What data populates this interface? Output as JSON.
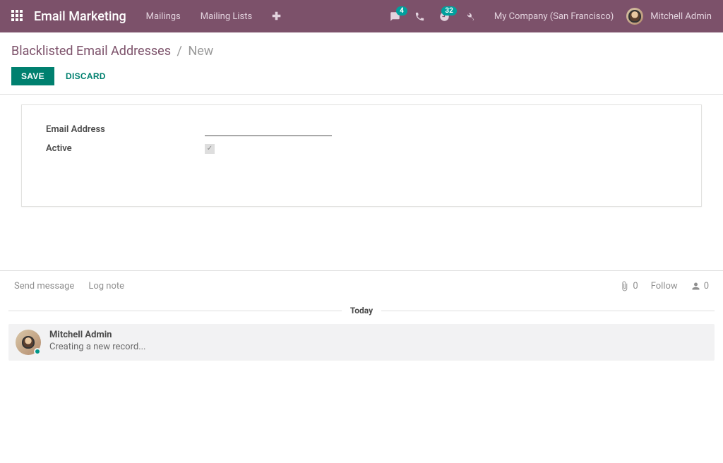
{
  "colors": {
    "primary": "#7c516a",
    "accent": "#00806f",
    "badge": "#00a09d"
  },
  "navbar": {
    "brand": "Email Marketing",
    "links": {
      "mailings": "Mailings",
      "mailing_lists": "Mailing Lists"
    },
    "messages_badge": "4",
    "activities_badge": "32",
    "company": "My Company (San Francisco)",
    "user_name": "Mitchell Admin"
  },
  "breadcrumb": {
    "parent": "Blacklisted Email Addresses",
    "current": "New"
  },
  "buttons": {
    "save": "SAVE",
    "discard": "DISCARD"
  },
  "form": {
    "email_label": "Email Address",
    "email_value": "",
    "active_label": "Active",
    "active_checked": true
  },
  "chatter": {
    "send_message": "Send message",
    "log_note": "Log note",
    "attachments_count": "0",
    "follow_label": "Follow",
    "followers_count": "0",
    "today_label": "Today",
    "messages": [
      {
        "author": "Mitchell Admin",
        "body": "Creating a new record..."
      }
    ]
  }
}
